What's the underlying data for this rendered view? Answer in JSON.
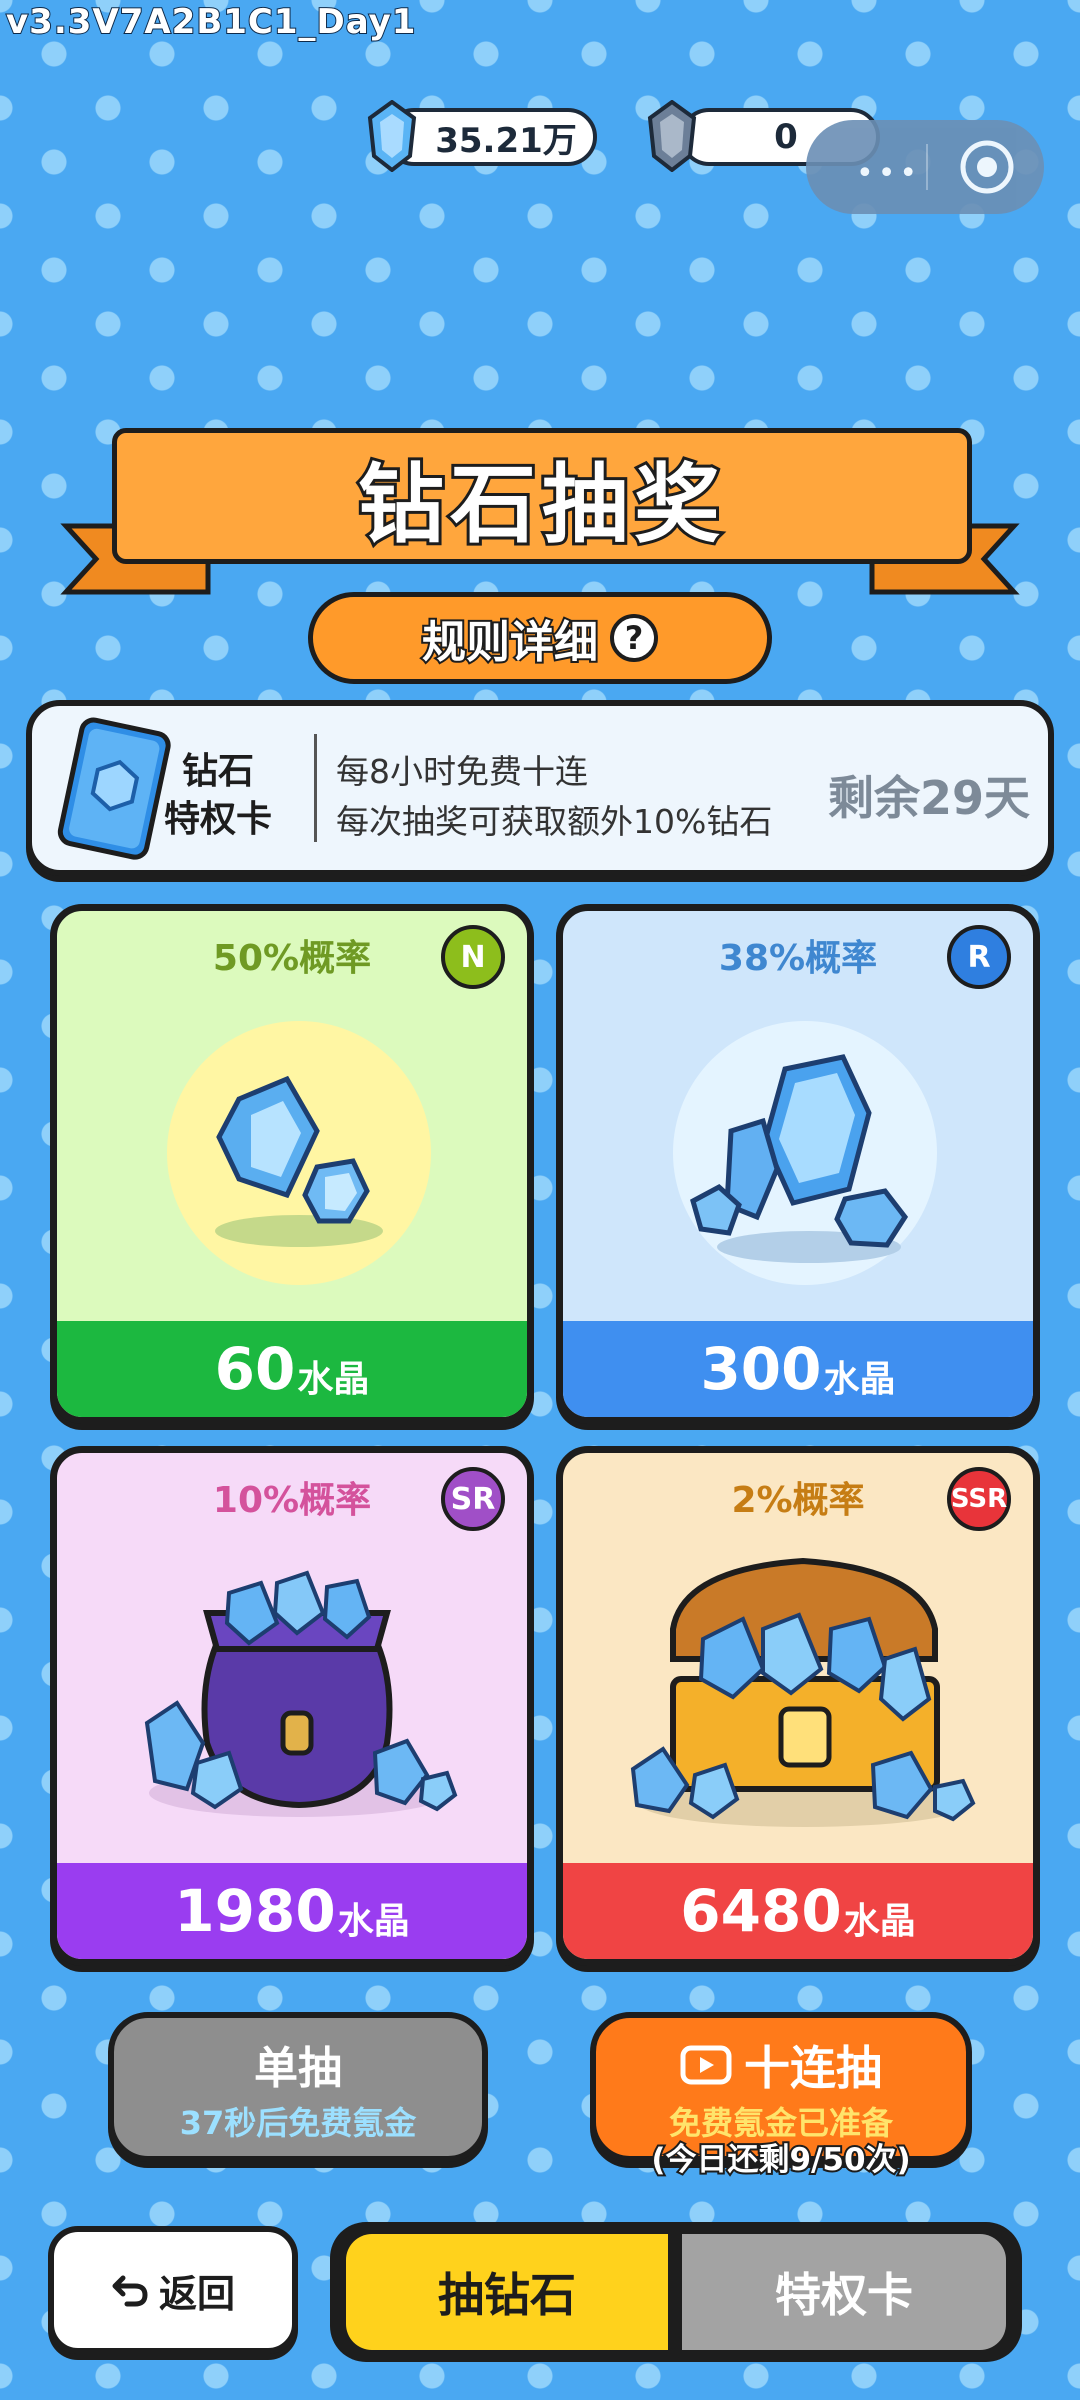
{
  "header": {
    "version": "v3.3V7A2B1C1_Day1",
    "crystal_amount": "35.21万",
    "shard_amount": "0"
  },
  "banner": {
    "title": "钻石抽奖",
    "rules_label": "规则详细",
    "help_glyph": "?"
  },
  "vip_card": {
    "title_line1": "钻石",
    "title_line2": "特权卡",
    "desc_line1": "每8小时免费十连",
    "desc_line2": "每次抽奖可获取额外10%钻石",
    "remaining": "剩余29天"
  },
  "prizes": [
    {
      "probability": "50%概率",
      "rarity": "N",
      "amount": "60",
      "unit": "水晶"
    },
    {
      "probability": "38%概率",
      "rarity": "R",
      "amount": "300",
      "unit": "水晶"
    },
    {
      "probability": "10%概率",
      "rarity": "SR",
      "amount": "1980",
      "unit": "水晶"
    },
    {
      "probability": "2%概率",
      "rarity": "SSR",
      "amount": "6480",
      "unit": "水晶"
    }
  ],
  "actions": {
    "single_label": "单抽",
    "single_sub": "37秒后免费氪金",
    "ten_label": "十连抽",
    "ten_sub": "免费氪金已准备",
    "ten_note": "(今日还剩9/50次)"
  },
  "bottom": {
    "back_label": "返回",
    "tab_draw": "抽钻石",
    "tab_vip": "特权卡"
  },
  "colors": {
    "background": "#4aa8f2",
    "banner": "#ffa63d",
    "tab_active": "#ffd21c",
    "ten_button": "#ff7a1a"
  }
}
